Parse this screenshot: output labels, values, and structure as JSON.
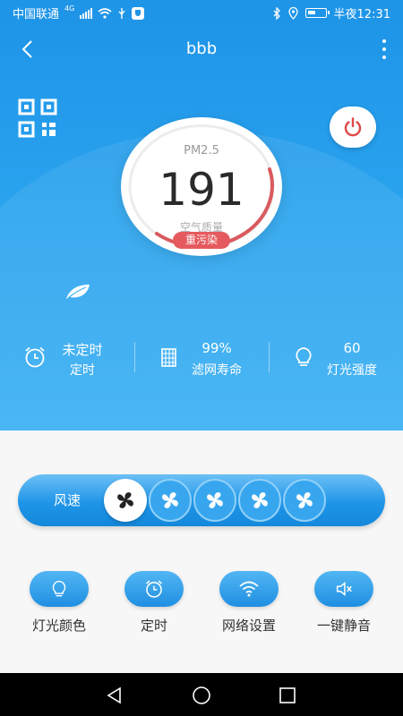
{
  "status_bar": {
    "carrier": "中国联通",
    "network": "4G",
    "time": "半夜12:31",
    "icons": [
      "signal-icon",
      "wifi-icon",
      "usb-icon",
      "shield-app-icon",
      "bluetooth-icon",
      "location-icon",
      "battery-icon"
    ]
  },
  "header": {
    "title": "bbb",
    "back_icon": "chevron-left-icon",
    "menu_icon": "more-vertical-icon"
  },
  "air_quality": {
    "pm_label": "PM2.5",
    "pm_value": "191",
    "quality_label": "空气质量",
    "quality_level": "重污染",
    "level_color": "#e55a5e"
  },
  "stats": [
    {
      "icon": "alarm-clock-icon",
      "value": "未定时",
      "label": "定时"
    },
    {
      "icon": "filter-icon",
      "value": "99%",
      "label": "滤网寿命"
    },
    {
      "icon": "lightbulb-icon",
      "value": "60",
      "label": "灯光强度"
    }
  ],
  "fan_speed": {
    "label": "风速",
    "levels": 5,
    "selected_level": 1
  },
  "actions": [
    {
      "icon": "lightbulb-icon",
      "label": "灯光颜色"
    },
    {
      "icon": "alarm-clock-icon",
      "label": "定时"
    },
    {
      "icon": "wifi-icon",
      "label": "网络设置"
    },
    {
      "icon": "mute-icon",
      "label": "一键静音"
    }
  ],
  "colors": {
    "primary": "#1f95e8",
    "danger": "#e55a5e",
    "power_icon": "#e04848",
    "background": "#f7f7f7"
  }
}
